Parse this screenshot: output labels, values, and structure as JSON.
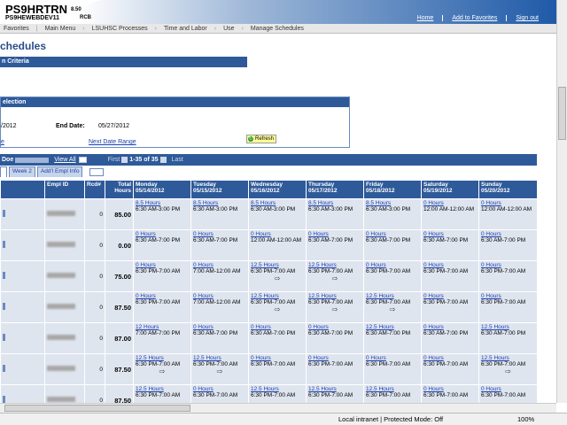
{
  "header": {
    "title": "PS9HRTRN",
    "version": "8.50",
    "database": "PS9HEWEBDEV11",
    "code": "RCB",
    "links": [
      "Home",
      "Add to Favorites",
      "Sign out"
    ]
  },
  "breadcrumb": [
    "Favorites",
    "Main Menu",
    "LSUHSC Processes",
    "Time and Labor",
    "Use",
    "Manage Schedules"
  ],
  "page_title": "chedules",
  "criteria_header": "n Criteria",
  "selection": {
    "header": "election",
    "start_date_partial": "/2012",
    "end_date_label": "End Date:",
    "end_date_value": "05/27/2012",
    "prev_link_partial": "e",
    "next_link": "Next Date Range",
    "refresh_label": "Refresh"
  },
  "grid_bar": {
    "name": "Doe",
    "view_all": "View All",
    "first": "First",
    "count": "1-35 of 35",
    "last": "Last"
  },
  "tabs": [
    "Week 2",
    "Add'l Empl Info"
  ],
  "columns": {
    "empl_id": "Empl ID",
    "rcd": "Rcd#",
    "total_hours": "Total Hours",
    "days": [
      {
        "name": "Monday",
        "date": "05/14/2012"
      },
      {
        "name": "Tuesday",
        "date": "05/15/2012"
      },
      {
        "name": "Wednesday",
        "date": "05/16/2012"
      },
      {
        "name": "Thursday",
        "date": "05/17/2012"
      },
      {
        "name": "Friday",
        "date": "05/18/2012"
      },
      {
        "name": "Saturday",
        "date": "05/19/2012"
      },
      {
        "name": "Sunday",
        "date": "05/20/2012"
      }
    ]
  },
  "rows": [
    {
      "rcd": "0",
      "total": "85.00",
      "days": [
        {
          "h": "8.5 Hours",
          "t": "6:30 AM-3:00 PM",
          "a": false
        },
        {
          "h": "8.5 Hours",
          "t": "6:30 AM-3:00 PM",
          "a": false
        },
        {
          "h": "8.5 Hours",
          "t": "6:30 AM-3:00 PM",
          "a": false
        },
        {
          "h": "8.5 Hours",
          "t": "6:30 AM-3:00 PM",
          "a": false
        },
        {
          "h": "8.5 Hours",
          "t": "6:30 AM-3:00 PM",
          "a": false
        },
        {
          "h": "0 Hours",
          "t": "12:00 AM-12:00 AM",
          "a": false
        },
        {
          "h": "0 Hours",
          "t": "12:00 AM-12:00 AM",
          "a": false
        }
      ]
    },
    {
      "rcd": "0",
      "total": "0.00",
      "days": [
        {
          "h": "0 Hours",
          "t": "6:30 AM-7:00 PM",
          "a": false
        },
        {
          "h": "0 Hours",
          "t": "6:30 AM-7:00 PM",
          "a": false
        },
        {
          "h": "0 Hours",
          "t": "12:00 AM-12:00 AM",
          "a": false
        },
        {
          "h": "0 Hours",
          "t": "6:30 AM-7:00 PM",
          "a": false
        },
        {
          "h": "0 Hours",
          "t": "6:30 AM-7:00 PM",
          "a": false
        },
        {
          "h": "0 Hours",
          "t": "6:30 AM-7:00 PM",
          "a": false
        },
        {
          "h": "0 Hours",
          "t": "6:30 AM-7:00 PM",
          "a": false
        }
      ]
    },
    {
      "rcd": "0",
      "total": "75.00",
      "days": [
        {
          "h": "0 Hours",
          "t": "6:30 PM-7:00 AM",
          "a": false
        },
        {
          "h": "0 Hours",
          "t": "7:00 AM-12:00 AM",
          "a": false
        },
        {
          "h": "12.5 Hours",
          "t": "6:30 PM-7:00 AM",
          "a": true
        },
        {
          "h": "12.5 Hours",
          "t": "6:30 PM-7:00 AM",
          "a": true
        },
        {
          "h": "0 Hours",
          "t": "6:30 PM-7:00 AM",
          "a": false
        },
        {
          "h": "0 Hours",
          "t": "6:30 PM-7:00 AM",
          "a": false
        },
        {
          "h": "0 Hours",
          "t": "6:30 PM-7:00 AM",
          "a": false
        }
      ]
    },
    {
      "rcd": "0",
      "total": "87.50",
      "days": [
        {
          "h": "0 Hours",
          "t": "6:30 PM-7:00 AM",
          "a": false
        },
        {
          "h": "0 Hours",
          "t": "7:00 AM-12:00 AM",
          "a": false
        },
        {
          "h": "12.5 Hours",
          "t": "6:30 PM-7:00 AM",
          "a": true
        },
        {
          "h": "12.5 Hours",
          "t": "6:30 PM-7:00 AM",
          "a": true
        },
        {
          "h": "12.5 Hours",
          "t": "6:30 PM-7:00 AM",
          "a": true
        },
        {
          "h": "0 Hours",
          "t": "6:30 PM-7:00 AM",
          "a": false
        },
        {
          "h": "0 Hours",
          "t": "6:30 PM-7:00 AM",
          "a": false
        }
      ]
    },
    {
      "rcd": "0",
      "total": "87.00",
      "days": [
        {
          "h": "12 Hours",
          "t": "7:00 AM-7:00 PM",
          "a": false
        },
        {
          "h": "0 Hours",
          "t": "6:30 AM-7:00 PM",
          "a": false
        },
        {
          "h": "0 Hours",
          "t": "6:30 AM-7:00 PM",
          "a": false
        },
        {
          "h": "0 Hours",
          "t": "6:30 AM-7:00 PM",
          "a": false
        },
        {
          "h": "12.5 Hours",
          "t": "6:30 AM-7:00 PM",
          "a": false
        },
        {
          "h": "0 Hours",
          "t": "6:30 AM-7:00 PM",
          "a": false
        },
        {
          "h": "12.5 Hours",
          "t": "6:30 AM-7:00 PM",
          "a": false
        }
      ]
    },
    {
      "rcd": "0",
      "total": "87.50",
      "days": [
        {
          "h": "12.5 Hours",
          "t": "6:30 PM-7:00 AM",
          "a": true
        },
        {
          "h": "12.5 Hours",
          "t": "6:30 PM-7:00 AM",
          "a": true
        },
        {
          "h": "0 Hours",
          "t": "6:30 PM-7:00 AM",
          "a": false
        },
        {
          "h": "0 Hours",
          "t": "6:30 PM-7:00 AM",
          "a": false
        },
        {
          "h": "0 Hours",
          "t": "6:30 PM-7:00 AM",
          "a": false
        },
        {
          "h": "0 Hours",
          "t": "6:30 PM-7:00 AM",
          "a": false
        },
        {
          "h": "12.5 Hours",
          "t": "6:30 PM-7:00 AM",
          "a": true
        }
      ]
    },
    {
      "rcd": "0",
      "total": "87.50",
      "days": [
        {
          "h": "12.5 Hours",
          "t": "6:30 PM-7:00 AM",
          "a": false
        },
        {
          "h": "0 Hours",
          "t": "6:30 PM-7:00 AM",
          "a": false
        },
        {
          "h": "12.5 Hours",
          "t": "6:30 PM-7:00 AM",
          "a": false
        },
        {
          "h": "12.5 Hours",
          "t": "6:30 PM-7:00 AM",
          "a": false
        },
        {
          "h": "12.5 Hours",
          "t": "6:30 PM-7:00 AM",
          "a": false
        },
        {
          "h": "0 Hours",
          "t": "6:30 PM-7:00 AM",
          "a": false
        },
        {
          "h": "0 Hours",
          "t": "6:30 PM-7:00 AM",
          "a": false
        }
      ]
    }
  ],
  "status": {
    "zone": "Local intranet | Protected Mode: Off",
    "zoom": "100%"
  }
}
